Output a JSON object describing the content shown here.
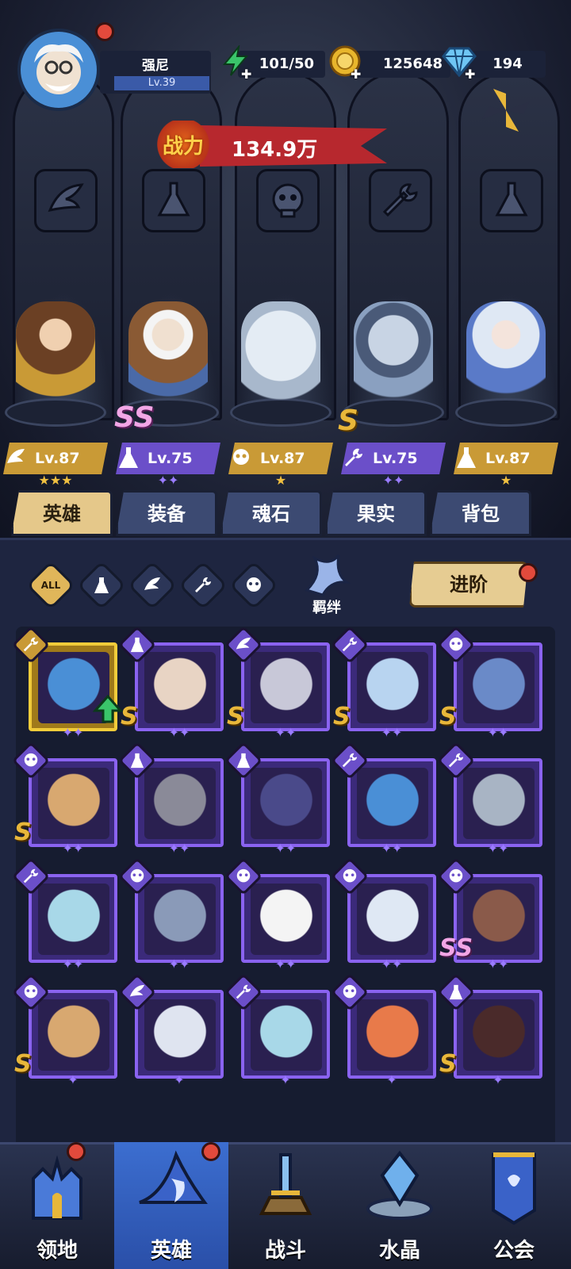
{
  "player": {
    "name": "强尼",
    "level": "Lv.39"
  },
  "resources": {
    "energy": "101/50",
    "gold": "125648",
    "diamond": "194"
  },
  "power": {
    "label": "战力",
    "value": "134.9万"
  },
  "lineup": [
    {
      "level": "Lv.87",
      "class_icon": "wing-icon",
      "plate": "gold",
      "stars": "★★★",
      "tag": ""
    },
    {
      "level": "Lv.75",
      "class_icon": "flask-icon",
      "plate": "purple",
      "stars": "✦✦",
      "tag": "SS"
    },
    {
      "level": "Lv.87",
      "class_icon": "skull-icon",
      "plate": "gold",
      "stars": "★",
      "tag": ""
    },
    {
      "level": "Lv.75",
      "class_icon": "wrench-icon",
      "plate": "purple",
      "stars": "✦✦",
      "tag": "S"
    },
    {
      "level": "Lv.87",
      "class_icon": "flask-icon",
      "plate": "gold",
      "stars": "★",
      "tag": ""
    }
  ],
  "tabs": [
    "英雄",
    "装备",
    "魂石",
    "果实",
    "背包"
  ],
  "filters": {
    "all_label": "ALL",
    "bond_label": "羁绊",
    "advance_label": "进阶"
  },
  "grid": [
    {
      "cls": "wrench-icon",
      "tag": "",
      "stars": "✦✦",
      "gold": true,
      "upgrade": true
    },
    {
      "cls": "flask-icon",
      "tag": "S",
      "stars": "✦✦"
    },
    {
      "cls": "wing-icon",
      "tag": "S",
      "stars": "✦✦"
    },
    {
      "cls": "wrench-icon",
      "tag": "S",
      "stars": "✦✦"
    },
    {
      "cls": "skull-icon",
      "tag": "S",
      "stars": "✦✦"
    },
    {
      "cls": "skull-icon",
      "tag": "S",
      "stars": "✦✦"
    },
    {
      "cls": "flask-icon",
      "tag": "",
      "stars": "✦✦"
    },
    {
      "cls": "flask-icon",
      "tag": "",
      "stars": "✦✦"
    },
    {
      "cls": "wrench-icon",
      "tag": "",
      "stars": "✦✦"
    },
    {
      "cls": "wrench-icon",
      "tag": "",
      "stars": "✦✦"
    },
    {
      "cls": "wrench-icon",
      "tag": "",
      "stars": "✦✦"
    },
    {
      "cls": "skull-icon",
      "tag": "",
      "stars": "✦✦"
    },
    {
      "cls": "skull-icon",
      "tag": "",
      "stars": "✦✦"
    },
    {
      "cls": "skull-icon",
      "tag": "",
      "stars": "✦✦"
    },
    {
      "cls": "skull-icon",
      "tag": "SS",
      "stars": "✦✦"
    },
    {
      "cls": "skull-icon",
      "tag": "S",
      "stars": "✦"
    },
    {
      "cls": "wing-icon",
      "tag": "",
      "stars": "✦"
    },
    {
      "cls": "wrench-icon",
      "tag": "",
      "stars": "✦"
    },
    {
      "cls": "skull-icon",
      "tag": "",
      "stars": "✦"
    },
    {
      "cls": "flask-icon",
      "tag": "S",
      "stars": "✦"
    }
  ],
  "nav": [
    {
      "label": "领地",
      "icon": "castle-icon",
      "badge": true
    },
    {
      "label": "英雄",
      "icon": "hero-hat-icon",
      "badge": true,
      "active": true
    },
    {
      "label": "战斗",
      "icon": "battle-sword-icon"
    },
    {
      "label": "水晶",
      "icon": "crystal-icon"
    },
    {
      "label": "公会",
      "icon": "guild-banner-icon"
    }
  ]
}
